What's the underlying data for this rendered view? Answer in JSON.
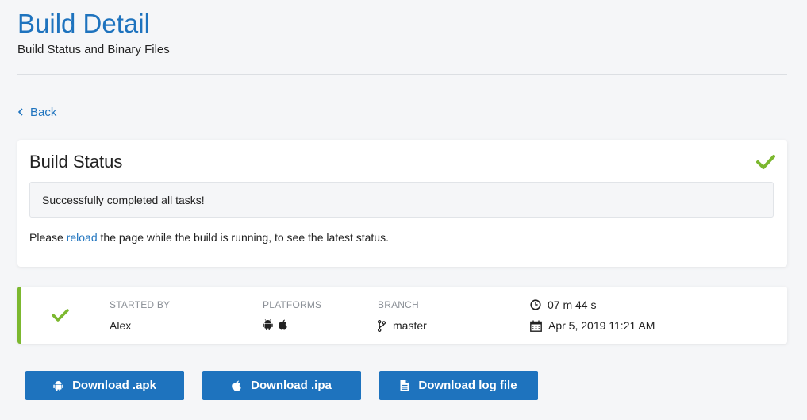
{
  "header": {
    "title": "Build Detail",
    "subtitle": "Build Status and Binary Files"
  },
  "nav": {
    "back_label": "Back"
  },
  "build_status": {
    "title": "Build Status",
    "message": "Successfully completed all tasks!",
    "note_prefix": "Please ",
    "note_link": "reload",
    "note_suffix": " the page while the build is running, to see the latest status."
  },
  "build_info": {
    "started_by_label": "STARTED BY",
    "started_by": "Alex",
    "platforms_label": "PLATFORMS",
    "platforms": [
      "android-icon",
      "apple-icon"
    ],
    "branch_label": "BRANCH",
    "branch": "master",
    "duration": "07 m 44 s",
    "date": "Apr 5, 2019 11:21 AM"
  },
  "downloads": {
    "apk_label": "Download .apk",
    "ipa_label": "Download .ipa",
    "log_label": "Download log file"
  },
  "colors": {
    "accent": "#1e73be",
    "success": "#7cb82f",
    "background": "#f5f6f8"
  }
}
